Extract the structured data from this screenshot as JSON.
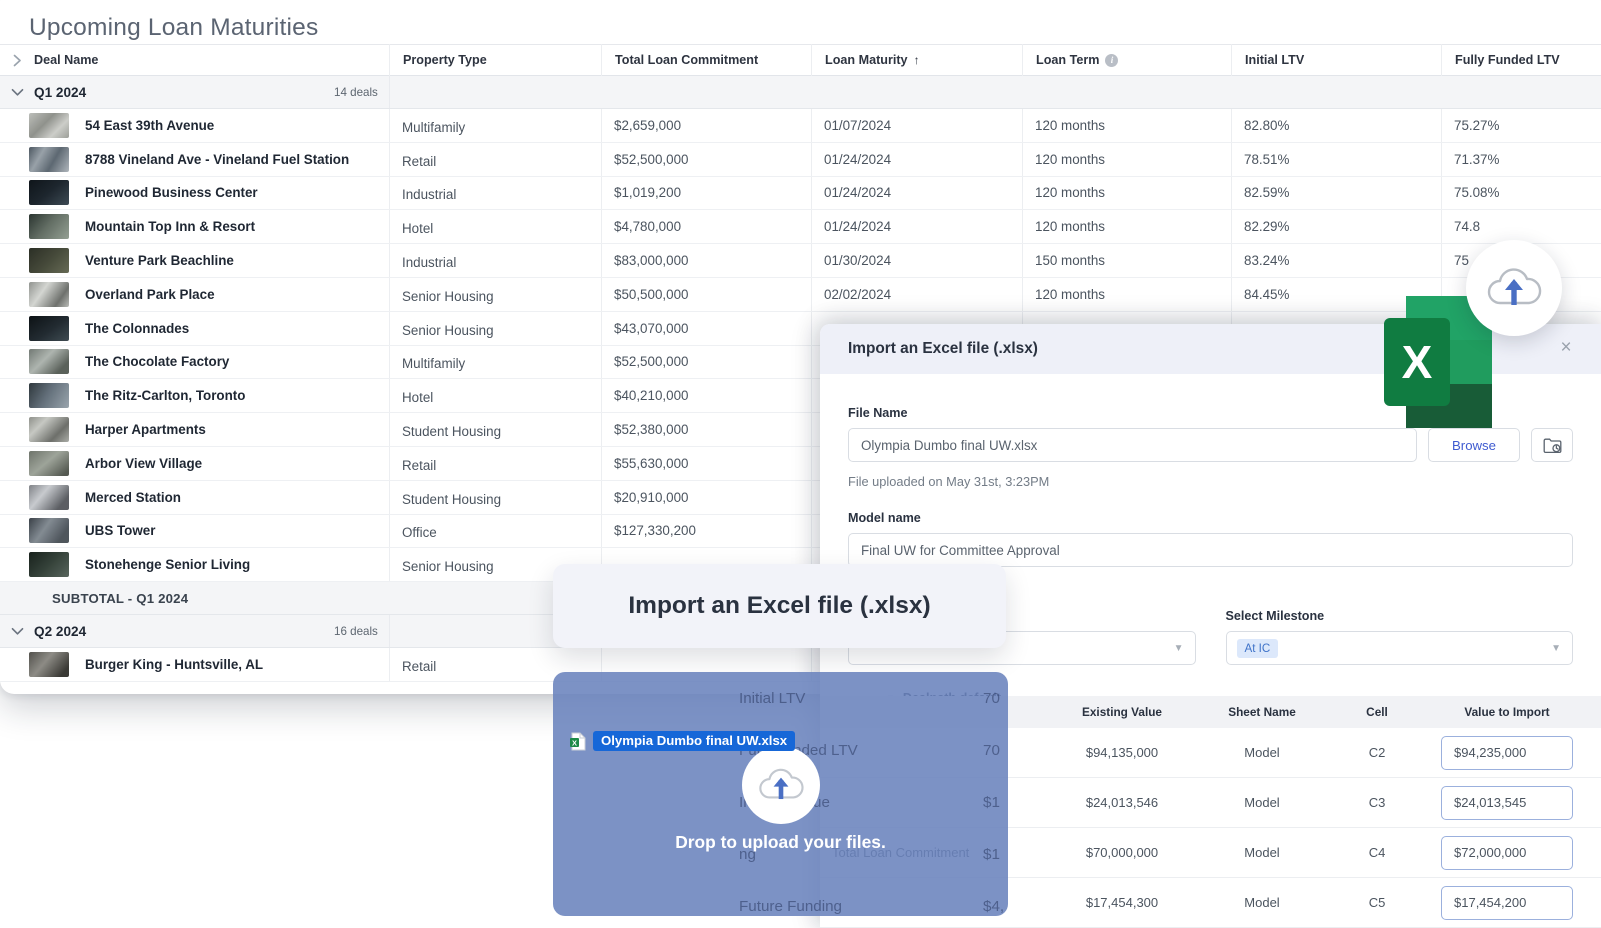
{
  "page": {
    "title": "Upcoming Loan Maturities"
  },
  "table": {
    "columns": [
      {
        "key": "deal_name",
        "label": "Deal Name"
      },
      {
        "key": "property_type",
        "label": "Property Type"
      },
      {
        "key": "total_loan_commitment",
        "label": "Total Loan Commitment"
      },
      {
        "key": "loan_maturity",
        "label": "Loan Maturity",
        "sort": "↑"
      },
      {
        "key": "loan_term",
        "label": "Loan Term",
        "info_icon": "info-icon"
      },
      {
        "key": "initial_ltv",
        "label": "Initial LTV"
      },
      {
        "key": "fully_funded_ltv",
        "label": "Fully Funded LTV"
      }
    ],
    "groups": [
      {
        "label": "Q1 2024",
        "count": "14 deals",
        "expanded": true,
        "subtotal_label": "SUBTOTAL - Q1 2024",
        "rows": [
          {
            "deal_name": "54 East 39th Avenue",
            "property_type": "Multifamily",
            "total_loan_commitment": "$2,659,000",
            "loan_maturity": "01/07/2024",
            "loan_term": "120 months",
            "initial_ltv": "82.80%",
            "fully_funded_ltv": "75.27%"
          },
          {
            "deal_name": "8788 Vineland Ave - Vineland Fuel Station",
            "property_type": "Retail",
            "total_loan_commitment": "$52,500,000",
            "loan_maturity": "01/24/2024",
            "loan_term": "120 months",
            "initial_ltv": "78.51%",
            "fully_funded_ltv": "71.37%"
          },
          {
            "deal_name": "Pinewood Business Center",
            "property_type": "Industrial",
            "total_loan_commitment": "$1,019,200",
            "loan_maturity": "01/24/2024",
            "loan_term": "120 months",
            "initial_ltv": "82.59%",
            "fully_funded_ltv": "75.08%"
          },
          {
            "deal_name": "Mountain Top Inn & Resort",
            "property_type": "Hotel",
            "total_loan_commitment": "$4,780,000",
            "loan_maturity": "01/24/2024",
            "loan_term": "120 months",
            "initial_ltv": "82.29%",
            "fully_funded_ltv": "74.8"
          },
          {
            "deal_name": "Venture Park Beachline",
            "property_type": "Industrial",
            "total_loan_commitment": "$83,000,000",
            "loan_maturity": "01/30/2024",
            "loan_term": "150 months",
            "initial_ltv": "83.24%",
            "fully_funded_ltv": "75"
          },
          {
            "deal_name": "Overland Park Place",
            "property_type": "Senior Housing",
            "total_loan_commitment": "$50,500,000",
            "loan_maturity": "02/02/2024",
            "loan_term": "120 months",
            "initial_ltv": "84.45%",
            "fully_funded_ltv": ""
          },
          {
            "deal_name": "The Colonnades",
            "property_type": "Senior Housing",
            "total_loan_commitment": "$43,070,000",
            "loan_maturity": "",
            "loan_term": "",
            "initial_ltv": "",
            "fully_funded_ltv": ""
          },
          {
            "deal_name": "The Chocolate Factory",
            "property_type": "Multifamily",
            "total_loan_commitment": "$52,500,000",
            "loan_maturity": "",
            "loan_term": "",
            "initial_ltv": "",
            "fully_funded_ltv": ""
          },
          {
            "deal_name": "The Ritz-Carlton, Toronto",
            "property_type": "Hotel",
            "total_loan_commitment": "$40,210,000",
            "loan_maturity": "",
            "loan_term": "",
            "initial_ltv": "",
            "fully_funded_ltv": ""
          },
          {
            "deal_name": "Harper Apartments",
            "property_type": "Student Housing",
            "total_loan_commitment": "$52,380,000",
            "loan_maturity": "",
            "loan_term": "",
            "initial_ltv": "",
            "fully_funded_ltv": ""
          },
          {
            "deal_name": "Arbor View Village",
            "property_type": "Retail",
            "total_loan_commitment": "$55,630,000",
            "loan_maturity": "",
            "loan_term": "",
            "initial_ltv": "",
            "fully_funded_ltv": ""
          },
          {
            "deal_name": "Merced Station",
            "property_type": "Student Housing",
            "total_loan_commitment": "$20,910,000",
            "loan_maturity": "",
            "loan_term": "",
            "initial_ltv": "",
            "fully_funded_ltv": ""
          },
          {
            "deal_name": "UBS Tower",
            "property_type": "Office",
            "total_loan_commitment": "$127,330,200",
            "loan_maturity": "",
            "loan_term": "",
            "initial_ltv": "",
            "fully_funded_ltv": ""
          },
          {
            "deal_name": "Stonehenge Senior Living",
            "property_type": "Senior Housing",
            "total_loan_commitment": "",
            "loan_maturity": "",
            "loan_term": "",
            "initial_ltv": "",
            "fully_funded_ltv": ""
          }
        ]
      },
      {
        "label": "Q2 2024",
        "count": "16 deals",
        "expanded": true,
        "rows": [
          {
            "deal_name": "Burger King - Huntsville, AL",
            "property_type": "Retail",
            "total_loan_commitment": "",
            "loan_maturity": "",
            "loan_term": "",
            "initial_ltv": "",
            "fully_funded_ltv": ""
          }
        ]
      }
    ]
  },
  "modal": {
    "title": "Import an Excel file (.xlsx)",
    "close_label": "×",
    "file_name_label": "File Name",
    "file_name_value": "Olympia Dumbo final UW.xlsx",
    "browse_label": "Browse",
    "upload_hint": "File uploaded on May 31st, 3:23PM",
    "model_name_label": "Model name",
    "model_name_value": "Final UW for Committee Approval",
    "milestone_label": "Select Milestone",
    "milestone_value": "At IC",
    "section_label": "Dealpath default",
    "preview_columns": [
      "Existing Value",
      "Sheet Name",
      "Cell",
      "Value to Import"
    ],
    "preview_rows": [
      {
        "field": "",
        "existing_value": "$94,135,000",
        "sheet_name": "Model",
        "cell": "C2",
        "value_to_import": "$94,235,000"
      },
      {
        "field": "",
        "existing_value": "$24,013,546",
        "sheet_name": "Model",
        "cell": "C3",
        "value_to_import": "$24,013,545"
      },
      {
        "field": "Total Loan Commitment",
        "existing_value": "$70,000,000",
        "sheet_name": "Model",
        "cell": "C4",
        "value_to_import": "$72,000,000"
      },
      {
        "field": "",
        "existing_value": "$17,454,300",
        "sheet_name": "Model",
        "cell": "C5",
        "value_to_import": "$17,454,200"
      }
    ],
    "ghost_fields": [
      "Initial LTV",
      "Fully Funded LTV",
      "Implied Value",
      "ng",
      "Future Funding"
    ],
    "ghost_values": [
      "70",
      "70",
      "$1",
      "$1",
      "$4,"
    ]
  },
  "tooltip": {
    "text": "Import an Excel file (.xlsx)"
  },
  "drop_overlay": {
    "text": "Drop to upload your files.",
    "cloud_icon": "cloud-upload-icon"
  },
  "drag_pill": {
    "file_name": "Olympia Dumbo final UW.xlsx",
    "icon": "excel-file-icon"
  },
  "badges": {
    "cloud_upload_icon": "cloud-upload-icon",
    "excel_logo_icon": "excel-logo-icon"
  },
  "colors": {
    "accent_blue": "#3f5bd0",
    "excel_green": "#1d8a47",
    "overlay_blue": "#6a83bd",
    "chip_blue": "#dce8fb",
    "drag_pill_blue": "#1667d8"
  }
}
